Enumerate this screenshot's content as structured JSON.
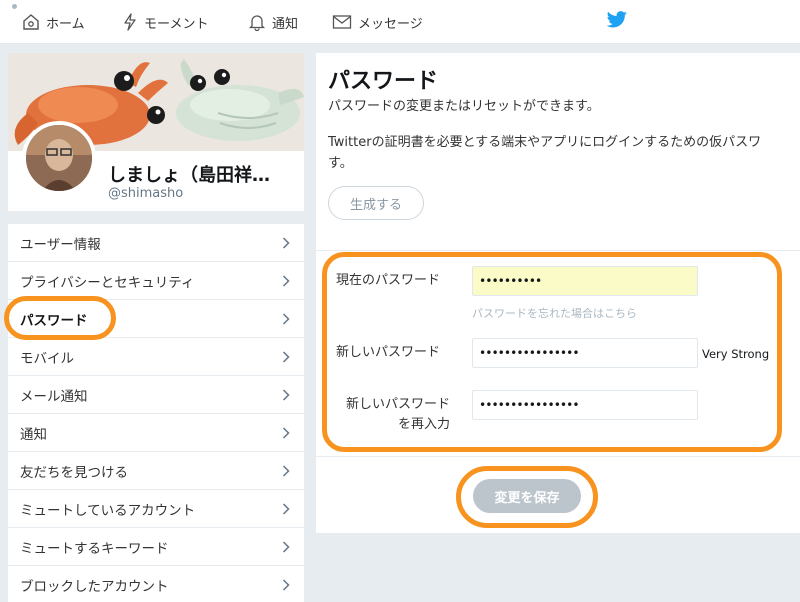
{
  "nav": {
    "items": [
      {
        "label": "ホーム",
        "icon": "home-icon"
      },
      {
        "label": "モーメント",
        "icon": "lightning-icon"
      },
      {
        "label": "通知",
        "icon": "bell-icon"
      },
      {
        "label": "メッセージ",
        "icon": "envelope-icon"
      }
    ],
    "logo": "twitter-bird-icon"
  },
  "profile": {
    "name": "しましょ（島田祥…",
    "handle": "@shimasho"
  },
  "sidebar": {
    "items": [
      {
        "label": "ユーザー情報"
      },
      {
        "label": "プライバシーとセキュリティ"
      },
      {
        "label": "パスワード",
        "active": true
      },
      {
        "label": "モバイル"
      },
      {
        "label": "メール通知"
      },
      {
        "label": "通知"
      },
      {
        "label": "友だちを見つける"
      },
      {
        "label": "ミュートしているアカウント"
      },
      {
        "label": "ミュートするキーワード"
      },
      {
        "label": "ブロックしたアカウント"
      }
    ]
  },
  "password": {
    "title": "パスワード",
    "subtitle": "パスワードの変更またはリセットができます。",
    "description": "Twitterの証明書を必要とする端末やアプリにログインするための仮パスワ",
    "description_cont": "す。",
    "generate_label": "生成する",
    "current_label": "現在のパスワード",
    "current_value": "••••••••••",
    "forgot_link": "パスワードを忘れた場合はこちら",
    "new_label": "新しいパスワード",
    "new_value": "••••••••••••••••",
    "strength": "Very Strong",
    "confirm_label_1": "新しいパスワード",
    "confirm_label_2": "を再入力",
    "confirm_value": "••••••••••••••••",
    "save_label": "変更を保存"
  },
  "colors": {
    "highlight": "#f7931e",
    "twitter_blue": "#1da1f2",
    "autofill_yellow": "#fafbc7"
  }
}
